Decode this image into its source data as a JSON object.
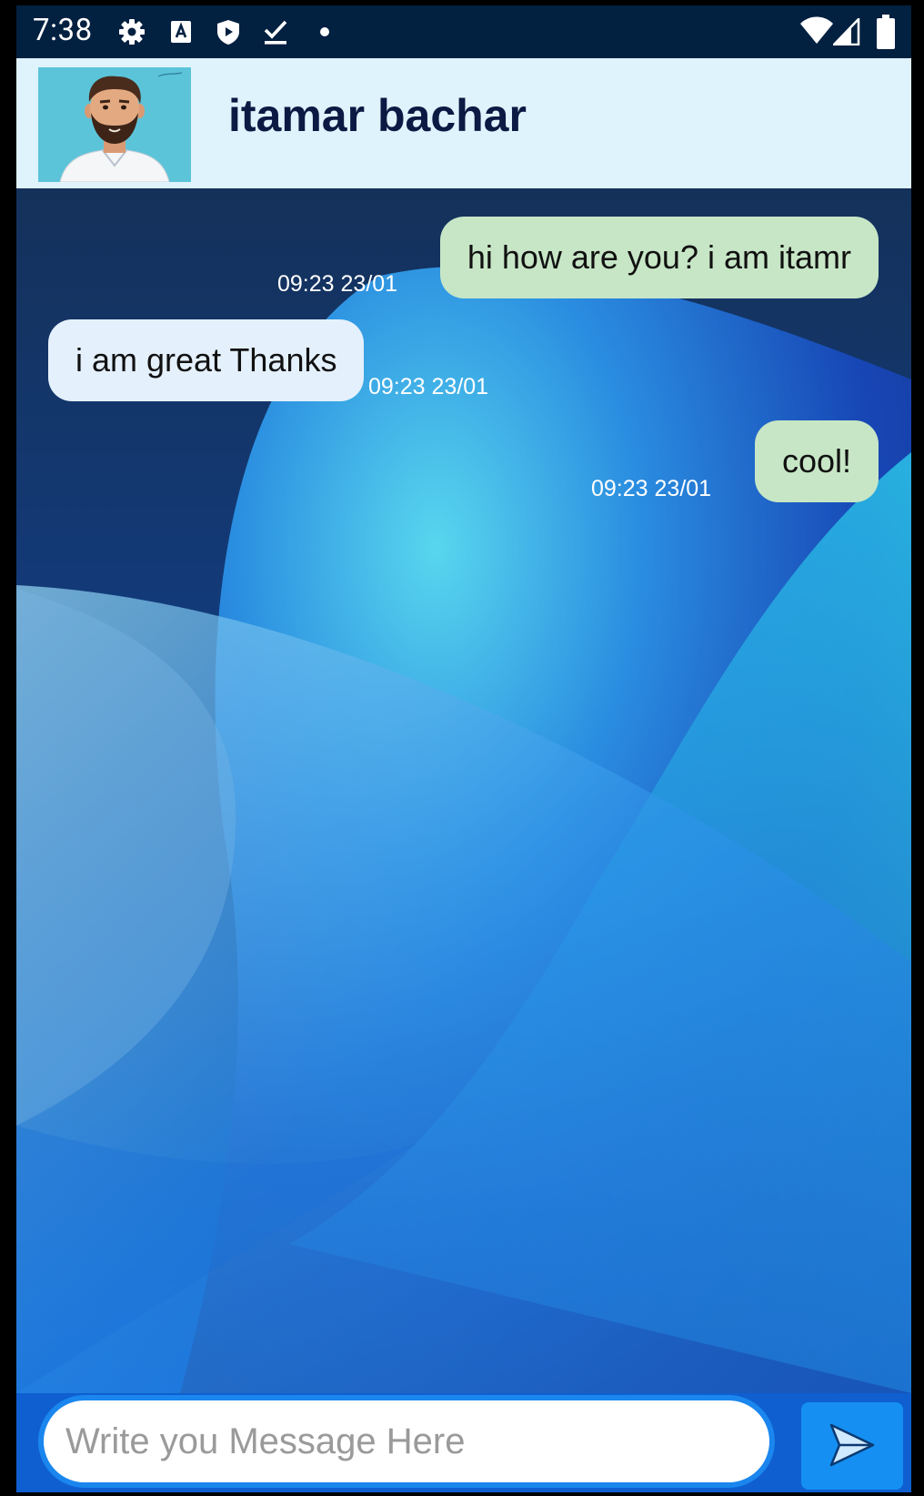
{
  "status_bar": {
    "time": "7:38",
    "icons": [
      "settings-gear-icon",
      "font-a-icon",
      "shield-play-icon",
      "download-check-icon",
      "notification-dot-icon",
      "wifi-icon",
      "cell-signal-icon",
      "battery-icon"
    ]
  },
  "header": {
    "contact_name": "itamar bachar",
    "avatar": "contact-avatar"
  },
  "messages": [
    {
      "direction": "sent",
      "text": "hi how are you? i am itamr",
      "time": "09:23 23/01"
    },
    {
      "direction": "received",
      "text": "i am great Thanks",
      "time": "09:23 23/01"
    },
    {
      "direction": "sent",
      "text": "cool!",
      "time": "09:23 23/01"
    }
  ],
  "composer": {
    "placeholder": "Write you Message Here",
    "value": "",
    "send_icon": "send-icon"
  },
  "colors": {
    "status_bar_bg": "#022040",
    "header_bg": "#dff3fd",
    "sent_bubble": "#c7e6c6",
    "received_bubble": "#e4f0fc",
    "input_bar_bg": "#0f5fd0",
    "send_button": "#1590f2"
  }
}
